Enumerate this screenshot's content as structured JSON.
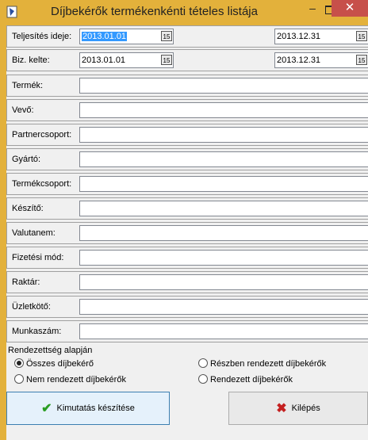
{
  "window": {
    "title": "Díjbekérők termékenkénti tételes listája",
    "minimize_glyph": "–",
    "close_glyph": "✕",
    "icon": "app-icon"
  },
  "filters": {
    "teljesites": {
      "label": "Teljesítés ideje:",
      "from": "2013.01.01",
      "to": "2013.12.31"
    },
    "kelte": {
      "label": "Biz. kelte:",
      "from": "2013.01.01",
      "to": "2013.12.31"
    },
    "calendar_glyph": "15",
    "fields": [
      {
        "label": "Termék:",
        "value": ""
      },
      {
        "label": "Vevő:",
        "value": ""
      },
      {
        "label": "Partnercsoport:",
        "value": ""
      },
      {
        "label": "Gyártó:",
        "value": ""
      },
      {
        "label": "Termékcsoport:",
        "value": ""
      },
      {
        "label": "Készítő:",
        "value": ""
      },
      {
        "label": "Valutanem:",
        "value": ""
      },
      {
        "label": "Fizetési mód:",
        "value": ""
      },
      {
        "label": "Raktár:",
        "value": ""
      },
      {
        "label": "Üzletkötő:",
        "value": ""
      },
      {
        "label": "Munkaszám:",
        "value": ""
      }
    ]
  },
  "sort": {
    "title": "Rendezettség alapján",
    "options": [
      {
        "label": "Összes díjbekérő",
        "selected": true
      },
      {
        "label": "Részben rendezett díjbekérők",
        "selected": false
      },
      {
        "label": "Nem rendezett díjbekérők",
        "selected": false
      },
      {
        "label": "Rendezett díjbekérők",
        "selected": false
      }
    ]
  },
  "buttons": {
    "report": {
      "label": "Kimutatás készítése",
      "icon": "check-icon"
    },
    "exit": {
      "label": "Kilépés",
      "icon": "close-x-icon"
    }
  },
  "colors": {
    "titlebar": "#e3b13b",
    "close": "#c7504a",
    "selection": "#3399ff"
  }
}
